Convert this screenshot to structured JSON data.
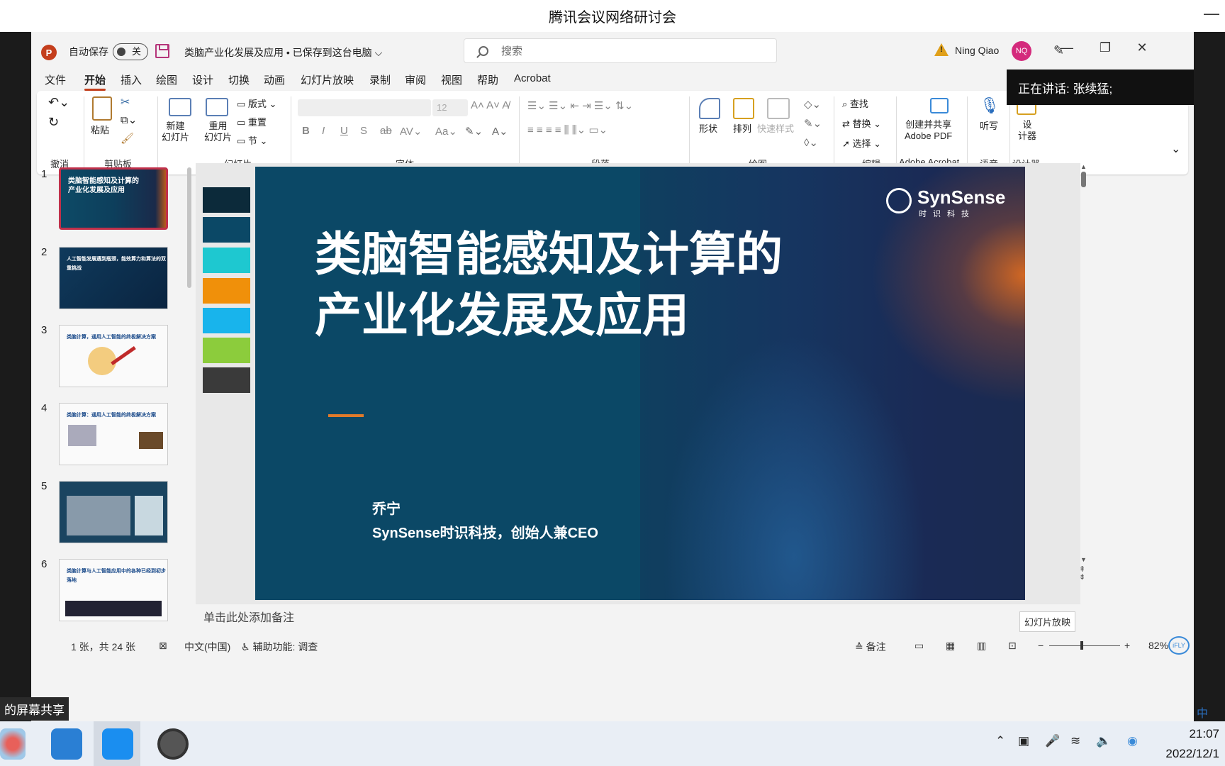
{
  "meeting": {
    "title": "腾讯会议网络研讨会",
    "min": "—"
  },
  "app": {
    "logo": "P",
    "autosave_label": "自动保存",
    "autosave_state": "关",
    "doc_title": "类脑产业化发展及应用 • 已保存到这台电脑 ⌵",
    "search_placeholder": "搜索",
    "user_name": "Ning Qiao",
    "user_initials": "NQ",
    "win_min": "—",
    "win_restore": "❐",
    "win_close": "✕"
  },
  "tabs": [
    "文件",
    "开始",
    "插入",
    "绘图",
    "设计",
    "切换",
    "动画",
    "幻灯片放映",
    "录制",
    "审阅",
    "视图",
    "帮助",
    "Acrobat"
  ],
  "ribbon": {
    "groups": {
      "undo": "撤消",
      "clipboard": "剪贴板",
      "slides": "幻灯片",
      "font": "字体",
      "paragraph": "段落",
      "drawing": "绘图",
      "editing": "编辑",
      "acrobat": "Adobe Acrobat",
      "voice": "语音",
      "designer": "设计器"
    },
    "paste": "粘贴",
    "new_slide": "新建\n幻灯片",
    "reuse_slide": "重用\n幻灯片",
    "layout": "版式",
    "reset": "重置",
    "section": "节",
    "font_size": "12",
    "shape": "形状",
    "arrange": "排列",
    "quick_styles": "快速样式",
    "find": "查找",
    "replace": "替换",
    "select": "选择",
    "create_pdf": "创建并共享\nAdobe PDF",
    "dictate": "听写",
    "designer_btn": "设\n计器"
  },
  "speaking": "正在讲话: 张续猛;",
  "thumbnails": [
    {
      "num": "1",
      "text": "类脑智能感知及计算的\n产业化发展及应用"
    },
    {
      "num": "2",
      "text": "人工智能发展遇到瓶颈，能效算力和算法的双重挑战"
    },
    {
      "num": "3",
      "text": "类脑计算，通用人工智能的终极解决方案"
    },
    {
      "num": "4",
      "text": "类脑计算：通用人工智能的终极解决方案"
    },
    {
      "num": "5",
      "text": ""
    },
    {
      "num": "6",
      "text": "类脑计算与人工智能应用中的各种已经到初步落地"
    }
  ],
  "swatch_colors": [
    "#0c2a3a",
    "#0b4866",
    "#1ec8d0",
    "#f0900a",
    "#18b4ec",
    "#8ccc3c",
    "#3a3a3a"
  ],
  "slide": {
    "title_line1": "类脑智能感知及计算的",
    "title_line2": "产业化发展及应用",
    "brand": "SynSense",
    "brand_sub": "时识科技",
    "author": "乔宁",
    "affiliation": "SynSense时识科技，创始人兼CEO"
  },
  "notes_placeholder": "单击此处添加备注",
  "tooltip": "幻灯片放映",
  "status": {
    "slide_count": "1 张，共 24 张",
    "language": "中文(中国)",
    "accessibility": "辅助功能: 调查",
    "notes": "备注",
    "zoom": "82%"
  },
  "screenshare": "的屏幕共享",
  "taskbar": {
    "time": "21:07",
    "date": "2022/12/1",
    "ime": "中"
  }
}
